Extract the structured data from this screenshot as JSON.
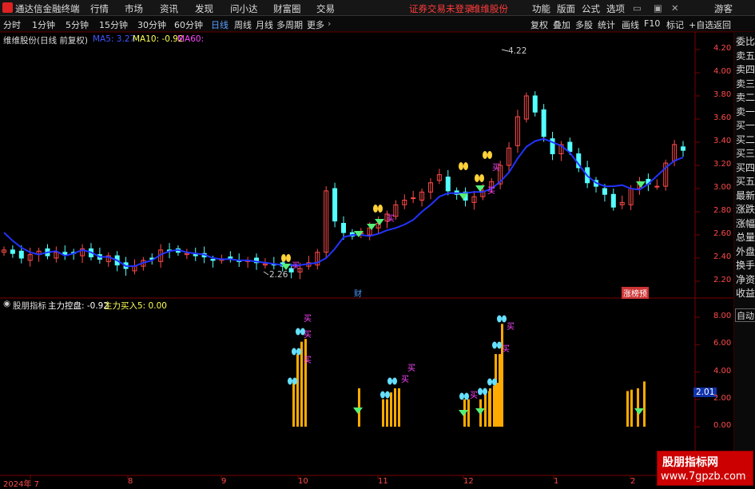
{
  "titlebar": {
    "app_name": "通达信金融终端",
    "menus": [
      "行情",
      "市场",
      "资讯",
      "发现",
      "问小达",
      "财富圈",
      "交易"
    ],
    "status_notice": "证券交易未登录",
    "stock_name": "维维股份",
    "right_menus": [
      "功能",
      "版面",
      "公式",
      "选项"
    ],
    "guest": "游客"
  },
  "toolbar": {
    "periods": [
      "分时",
      "1分钟",
      "5分钟",
      "15分钟",
      "30分钟",
      "60分钟",
      "日线",
      "周线",
      "月线",
      "多周期",
      "更多"
    ],
    "active_period": "日线",
    "right_buttons": [
      "复权",
      "叠加",
      "多股",
      "统计",
      "画线",
      "F10",
      "标记",
      "+自选",
      "返回"
    ]
  },
  "main_chart": {
    "title": "维维股份(日线 前复权)",
    "ma5_label": "MA5: 3.27",
    "ma10_label": "MA10: -0.92",
    "ma60_label": "MA60:",
    "high_label": "4.22",
    "low_label": "2.26",
    "y_ticks": [
      "4.20",
      "4.00",
      "3.80",
      "3.60",
      "3.40",
      "3.20",
      "3.00",
      "2.80",
      "2.60",
      "2.40",
      "2.20"
    ],
    "event_markers": [
      "财",
      "涨榜预"
    ],
    "buy_marker": "买"
  },
  "indicator": {
    "name": "股朋指标",
    "label_main": "主力控盘: -0.92",
    "label_buy": "主力买入5: 0.00",
    "y_ticks": [
      "8.00",
      "6.00",
      "4.00",
      "2.00",
      "0.00"
    ],
    "current_value": "2.01",
    "buy_marker": "买"
  },
  "x_axis": {
    "labels": [
      "2024年 7",
      "8",
      "9",
      "10",
      "11",
      "12",
      "1",
      "2"
    ]
  },
  "side_panel": {
    "items": [
      "委比",
      "卖五",
      "卖四",
      "卖三",
      "卖二",
      "卖一",
      "买一",
      "买二",
      "买三",
      "买四",
      "买五",
      "最新",
      "涨跌",
      "涨幅",
      "总量",
      "外盘",
      "换手",
      "净资",
      "收益"
    ],
    "auto_button": "自动"
  },
  "watermark": {
    "line1": "股朋指标网",
    "line2": "www.7gpzb.com"
  },
  "colors": {
    "up": "#ff4a4a",
    "down": "#54ffff",
    "ma5": "#2233ff",
    "ma10": "#ffff55",
    "ma60": "#ff44ff",
    "buy_bar": "#ffaa00",
    "accent": "#ff3c3c"
  },
  "chart_data": [
    {
      "type": "candlestick",
      "title": "维维股份(日线 前复权)",
      "x_labels": [
        "2024年 7",
        "8",
        "9",
        "10",
        "11",
        "12",
        "1",
        "2"
      ],
      "ylim": [
        2.1,
        4.3
      ],
      "y_ticks": [
        4.2,
        4.0,
        3.8,
        3.6,
        3.4,
        3.2,
        3.0,
        2.8,
        2.6,
        2.4,
        2.2
      ],
      "series_ma5": [
        2.62,
        2.55,
        2.49,
        2.45,
        2.43,
        2.45,
        2.46,
        2.42,
        2.44,
        2.47,
        2.45,
        2.41,
        2.41,
        2.38,
        2.33,
        2.33,
        2.36,
        2.38,
        2.43,
        2.46,
        2.47,
        2.45,
        2.44,
        2.43,
        2.4,
        2.39,
        2.39,
        2.38,
        2.38,
        2.37,
        2.36,
        2.35,
        2.34,
        2.34,
        2.34,
        2.35,
        2.36,
        2.4,
        2.48,
        2.58,
        2.6,
        2.6,
        2.59,
        2.61,
        2.64,
        2.66,
        2.69,
        2.73,
        2.8,
        2.86,
        2.93,
        2.96,
        2.96,
        2.96,
        2.97,
        2.97,
        3.0,
        3.06,
        3.14,
        3.26,
        3.36,
        3.41,
        3.43,
        3.4,
        3.37,
        3.31,
        3.21,
        3.11,
        3.05,
        3.02,
        3.02,
        3.03,
        3.0,
        2.99,
        3.04,
        3.11,
        3.18,
        3.24,
        3.27
      ],
      "high": 4.22,
      "low": 2.26
    },
    {
      "type": "bar",
      "title": "股朋指标",
      "ylim": [
        0,
        9
      ],
      "y_ticks": [
        8,
        6,
        4,
        2,
        0
      ],
      "series": [
        {
          "name": "主力控盘",
          "values": [
            3.3,
            5.3,
            6.2,
            3.3,
            2.8,
            2.0,
            2.0,
            2.5,
            2.8,
            2.0,
            2.0,
            2.0,
            2.5,
            2.8,
            5.3,
            7.5,
            2.6,
            2.7,
            3.3
          ]
        }
      ],
      "current_value": 2.01
    }
  ]
}
